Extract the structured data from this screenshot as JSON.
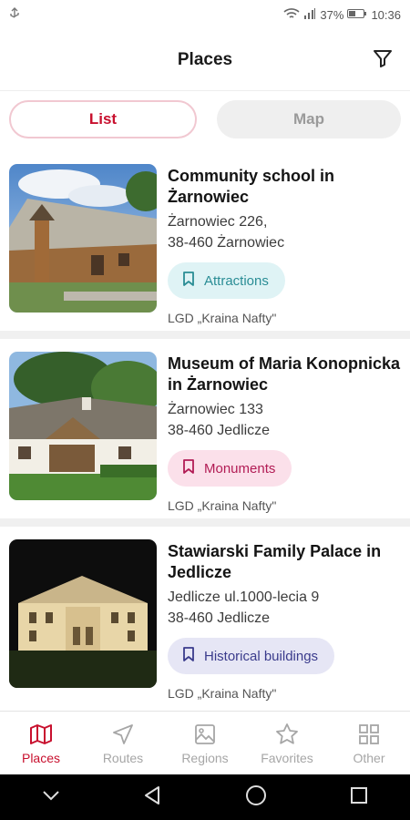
{
  "status_bar": {
    "battery": "37%",
    "time": "10:36",
    "icons": [
      "usb-icon",
      "wifi-icon",
      "signal-icon",
      "battery-icon"
    ]
  },
  "header": {
    "title": "Places",
    "filter_icon": "filter-icon"
  },
  "view_toggle": {
    "list_label": "List",
    "map_label": "Map",
    "selected": "List"
  },
  "places": [
    {
      "title": "Community school in Żarnowiec",
      "address_line1": "Żarnowiec 226,",
      "address_line2": "38-460 Żarnowiec",
      "tag": "Attractions",
      "source": "LGD „Kraina Nafty\""
    },
    {
      "title": "Museum of Maria Konopnicka in Żarnowiec",
      "address_line1": "Żarnowiec 133",
      "address_line2": "38-460 Jedlicze",
      "tag": "Monuments",
      "source": "LGD „Kraina Nafty\""
    },
    {
      "title": "Stawiarski Family Palace in Jedlicze",
      "address_line1": "Jedlicze ul.1000-lecia 9",
      "address_line2": "38-460 Jedlicze",
      "tag": "Historical buildings",
      "source": "LGD „Kraina Nafty\""
    }
  ],
  "bottom_nav": {
    "items": [
      {
        "label": "Places",
        "icon": "map-icon",
        "active": true
      },
      {
        "label": "Routes",
        "icon": "navigation-arrow-icon",
        "active": false
      },
      {
        "label": "Regions",
        "icon": "image-icon",
        "active": false
      },
      {
        "label": "Favorites",
        "icon": "star-icon",
        "active": false
      },
      {
        "label": "Other",
        "icon": "grid-icon",
        "active": false
      }
    ]
  },
  "colors": {
    "accent": "#c8102e",
    "attractions_bg": "#dff3f5",
    "attractions_fg": "#2a8d95",
    "monuments_bg": "#fbe0ea",
    "monuments_fg": "#b21c55",
    "historical_bg": "#e6e6f5",
    "historical_fg": "#3a3b8c"
  }
}
